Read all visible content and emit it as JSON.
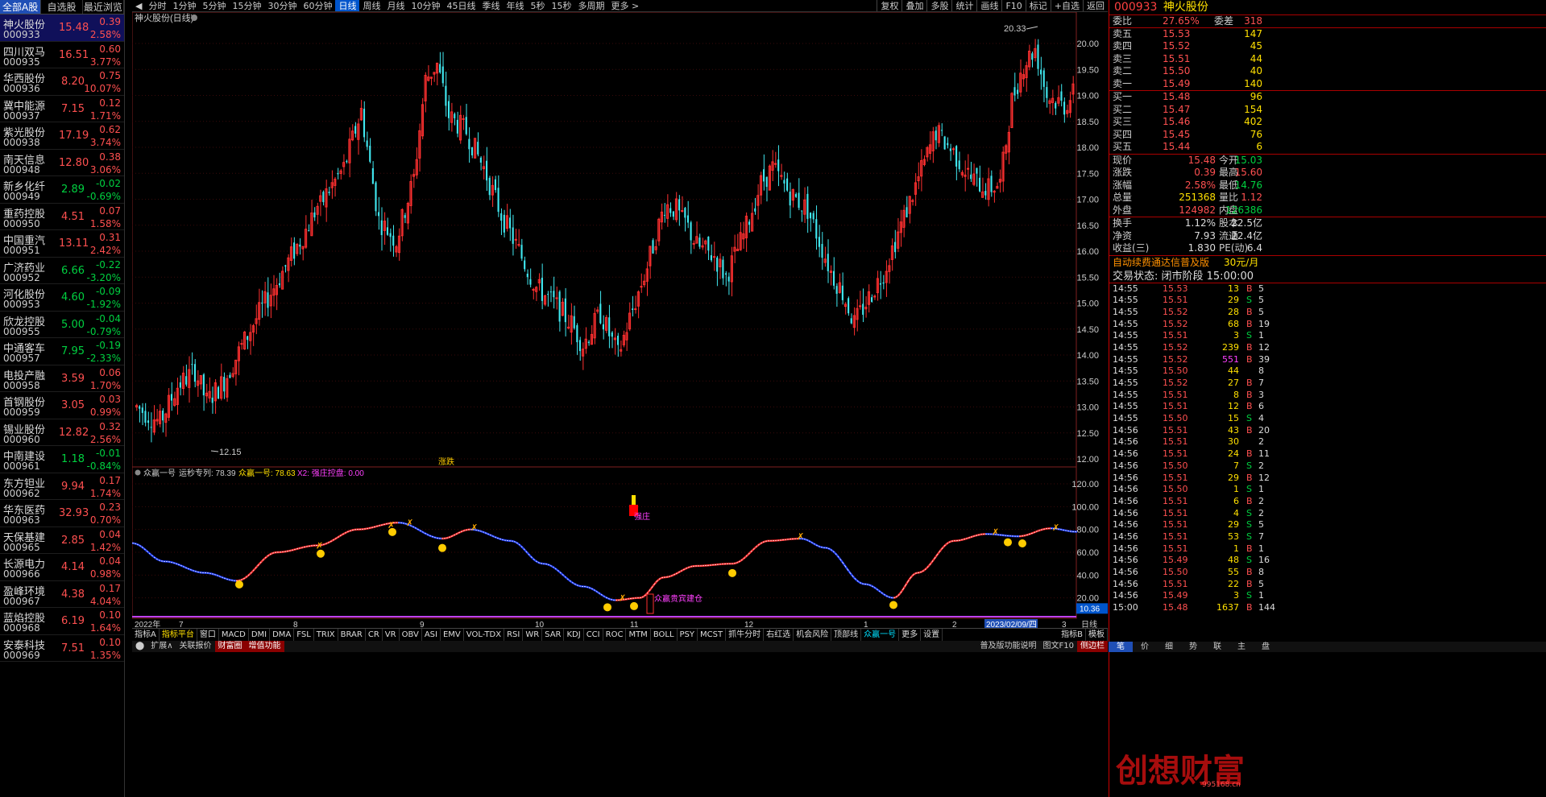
{
  "left_tabs": [
    "全部A股",
    "自选股",
    "最近浏览"
  ],
  "stocks": [
    {
      "name": "神火股份",
      "code": "000933",
      "price": "15.48",
      "chg": "0.39",
      "pct": "2.58%",
      "dir": "up",
      "sel": true
    },
    {
      "name": "四川双马",
      "code": "000935",
      "price": "16.51",
      "chg": "0.60",
      "pct": "3.77%",
      "dir": "up"
    },
    {
      "name": "华西股份",
      "code": "000936",
      "price": "8.20",
      "chg": "0.75",
      "pct": "10.07%",
      "dir": "up"
    },
    {
      "name": "冀中能源",
      "code": "000937",
      "price": "7.15",
      "chg": "0.12",
      "pct": "1.71%",
      "dir": "up"
    },
    {
      "name": "紫光股份",
      "code": "000938",
      "price": "17.19",
      "chg": "0.62",
      "pct": "3.74%",
      "dir": "up"
    },
    {
      "name": "南天信息",
      "code": "000948",
      "price": "12.80",
      "chg": "0.38",
      "pct": "3.06%",
      "dir": "up"
    },
    {
      "name": "新乡化纤",
      "code": "000949",
      "price": "2.89",
      "chg": "-0.02",
      "pct": "-0.69%",
      "dir": "dn"
    },
    {
      "name": "重药控股",
      "code": "000950",
      "price": "4.51",
      "chg": "0.07",
      "pct": "1.58%",
      "dir": "up"
    },
    {
      "name": "中国重汽",
      "code": "000951",
      "price": "13.11",
      "chg": "0.31",
      "pct": "2.42%",
      "dir": "up"
    },
    {
      "name": "广济药业",
      "code": "000952",
      "price": "6.66",
      "chg": "-0.22",
      "pct": "-3.20%",
      "dir": "dn"
    },
    {
      "name": "河化股份",
      "code": "000953",
      "price": "4.60",
      "chg": "-0.09",
      "pct": "-1.92%",
      "dir": "dn"
    },
    {
      "name": "欣龙控股",
      "code": "000955",
      "price": "5.00",
      "chg": "-0.04",
      "pct": "-0.79%",
      "dir": "dn"
    },
    {
      "name": "中通客车",
      "code": "000957",
      "price": "7.95",
      "chg": "-0.19",
      "pct": "-2.33%",
      "dir": "dn"
    },
    {
      "name": "电投产融",
      "code": "000958",
      "price": "3.59",
      "chg": "0.06",
      "pct": "1.70%",
      "dir": "up"
    },
    {
      "name": "首钢股份",
      "code": "000959",
      "price": "3.05",
      "chg": "0.03",
      "pct": "0.99%",
      "dir": "up"
    },
    {
      "name": "锡业股份",
      "code": "000960",
      "price": "12.82",
      "chg": "0.32",
      "pct": "2.56%",
      "dir": "up"
    },
    {
      "name": "中南建设",
      "code": "000961",
      "price": "1.18",
      "chg": "-0.01",
      "pct": "-0.84%",
      "dir": "dn"
    },
    {
      "name": "东方钽业",
      "code": "000962",
      "price": "9.94",
      "chg": "0.17",
      "pct": "1.74%",
      "dir": "up"
    },
    {
      "name": "华东医药",
      "code": "000963",
      "price": "32.93",
      "chg": "0.23",
      "pct": "0.70%",
      "dir": "up"
    },
    {
      "name": "天保基建",
      "code": "000965",
      "price": "2.85",
      "chg": "0.04",
      "pct": "1.42%",
      "dir": "up"
    },
    {
      "name": "长源电力",
      "code": "000966",
      "price": "4.14",
      "chg": "0.04",
      "pct": "0.98%",
      "dir": "up"
    },
    {
      "name": "盈峰环境",
      "code": "000967",
      "price": "4.38",
      "chg": "0.17",
      "pct": "4.04%",
      "dir": "up"
    },
    {
      "name": "蓝焰控股",
      "code": "000968",
      "price": "6.19",
      "chg": "0.10",
      "pct": "1.64%",
      "dir": "up"
    },
    {
      "name": "安泰科技",
      "code": "000969",
      "price": "7.51",
      "chg": "0.10",
      "pct": "1.35%",
      "dir": "up"
    }
  ],
  "topbar": {
    "periods": [
      "分时",
      "1分钟",
      "5分钟",
      "15分钟",
      "30分钟",
      "60分钟",
      "日线",
      "周线",
      "月线",
      "10分钟",
      "45日线",
      "季线",
      "年线",
      "5秒",
      "15秒",
      "多周期",
      "更多 >"
    ],
    "active": "日线",
    "right": [
      "复权",
      "叠加",
      "多股",
      "统计",
      "画线",
      "F10",
      "标记",
      "+自选",
      "返回"
    ]
  },
  "chart": {
    "title": "神火股份(日线)",
    "high_label": "20.33",
    "low_label": "12.15",
    "mark_label": "涨跌",
    "price_ticks": [
      "20.00",
      "19.50",
      "19.00",
      "18.50",
      "18.00",
      "17.50",
      "17.00",
      "16.50",
      "16.00",
      "15.50",
      "15.00",
      "14.50",
      "14.00",
      "13.50",
      "13.00",
      "12.50",
      "12.00"
    ],
    "ind_title": "众赢一号",
    "ind_items": [
      "运秒专列: 78.39",
      "众赢一号: 78.63",
      "X2: 强庄控盘: 0.00"
    ],
    "ind_ticks": [
      "120.00",
      "100.00",
      "80.00",
      "60.00",
      "40.00",
      "20.00"
    ],
    "ind_cur": "10.36",
    "ind_label1": "强庄",
    "ind_label2": "众赢贵宾建仓",
    "x_labels": [
      "2022年",
      "7",
      "8",
      "9",
      "10",
      "11",
      "12",
      "1",
      "2",
      "2023/02/09/四",
      "3"
    ],
    "x_unit": "日线"
  },
  "btmtabs": [
    "指标A",
    "指标平台",
    "窗口",
    "MACD",
    "DMI",
    "DMA",
    "FSL",
    "TRIX",
    "BRAR",
    "CR",
    "VR",
    "OBV",
    "ASI",
    "EMV",
    "VOL-TDX",
    "RSI",
    "WR",
    "SAR",
    "KDJ",
    "CCI",
    "ROC",
    "MTM",
    "BOLL",
    "PSY",
    "MCST",
    "抓牛分时",
    "右红选",
    "机会风险",
    "顶部线",
    "众赢一号",
    "更多",
    "设置",
    "指标B",
    "模板"
  ],
  "status": {
    "left": [
      "扩展∧",
      "关联报价",
      "财富圈",
      "增值功能"
    ],
    "right": [
      "普及版功能说明",
      "图文F10",
      "侧边栏"
    ]
  },
  "right": {
    "code": "000933",
    "name": "神火股份",
    "weibi": "27.65%",
    "weicha": "318",
    "asks": [
      [
        "卖五",
        "15.53",
        "147"
      ],
      [
        "卖四",
        "15.52",
        "45"
      ],
      [
        "卖三",
        "15.51",
        "44"
      ],
      [
        "卖二",
        "15.50",
        "40"
      ],
      [
        "卖一",
        "15.49",
        "140"
      ]
    ],
    "bids": [
      [
        "买一",
        "15.48",
        "96"
      ],
      [
        "买二",
        "15.47",
        "154"
      ],
      [
        "买三",
        "15.46",
        "402"
      ],
      [
        "买四",
        "15.45",
        "76"
      ],
      [
        "买五",
        "15.44",
        "6"
      ]
    ],
    "quote": [
      [
        "现价",
        "15.48",
        "今开",
        "15.03"
      ],
      [
        "涨跌",
        "0.39",
        "最高",
        "15.60"
      ],
      [
        "涨幅",
        "2.58%",
        "最低",
        "14.76"
      ],
      [
        "总量",
        "251368",
        "量比",
        "1.12"
      ],
      [
        "外盘",
        "124982",
        "内盘",
        "126386"
      ]
    ],
    "quote2": [
      [
        "换手",
        "1.12%",
        "股本",
        "22.5亿"
      ],
      [
        "净资",
        "7.93",
        "流通",
        "22.4亿"
      ],
      [
        "收益(三)",
        "1.830",
        "PE(动)",
        "6.4"
      ]
    ],
    "promo": "自动续费通达信普及版",
    "promo_price": "30元/月",
    "trade_state": "交易状态: 闭市阶段 15:00:00",
    "ticks": [
      [
        "14:55",
        "15.53",
        "13",
        "B",
        "5"
      ],
      [
        "14:55",
        "15.51",
        "29",
        "S",
        "5"
      ],
      [
        "14:55",
        "15.52",
        "28",
        "B",
        "5"
      ],
      [
        "14:55",
        "15.52",
        "68",
        "B",
        "19"
      ],
      [
        "14:55",
        "15.51",
        "3",
        "S",
        "1"
      ],
      [
        "14:55",
        "15.52",
        "239",
        "B",
        "12"
      ],
      [
        "14:55",
        "15.52",
        "551",
        "B",
        "39"
      ],
      [
        "14:55",
        "15.50",
        "44",
        "",
        "8"
      ],
      [
        "14:55",
        "15.52",
        "27",
        "B",
        "7"
      ],
      [
        "14:55",
        "15.51",
        "8",
        "B",
        "3"
      ],
      [
        "14:55",
        "15.51",
        "12",
        "B",
        "6"
      ],
      [
        "14:55",
        "15.50",
        "15",
        "S",
        "4"
      ],
      [
        "14:56",
        "15.51",
        "43",
        "B",
        "20"
      ],
      [
        "14:56",
        "15.51",
        "30",
        "",
        "2"
      ],
      [
        "14:56",
        "15.51",
        "24",
        "B",
        "11"
      ],
      [
        "14:56",
        "15.50",
        "7",
        "S",
        "2"
      ],
      [
        "14:56",
        "15.51",
        "29",
        "B",
        "12"
      ],
      [
        "14:56",
        "15.50",
        "1",
        "S",
        "1"
      ],
      [
        "14:56",
        "15.51",
        "6",
        "B",
        "2"
      ],
      [
        "14:56",
        "15.51",
        "4",
        "S",
        "2"
      ],
      [
        "14:56",
        "15.51",
        "29",
        "S",
        "5"
      ],
      [
        "14:56",
        "15.51",
        "53",
        "S",
        "7"
      ],
      [
        "14:56",
        "15.51",
        "1",
        "B",
        "1"
      ],
      [
        "14:56",
        "15.49",
        "48",
        "S",
        "16"
      ],
      [
        "14:56",
        "15.50",
        "55",
        "B",
        "8"
      ],
      [
        "14:56",
        "15.51",
        "22",
        "B",
        "5"
      ],
      [
        "14:56",
        "15.49",
        "3",
        "S",
        "1"
      ],
      [
        "15:00",
        "15.48",
        "1637",
        "B",
        "144"
      ]
    ],
    "rtabs": [
      "笔",
      "价",
      "细",
      "势",
      "联",
      "主",
      "盘"
    ]
  },
  "watermark": "创想财富",
  "watermark_url": "995168.cn",
  "colors": {
    "up": "#ff5050",
    "down": "#00d040",
    "cyan": "#40e0e0",
    "accent": "#1f4fb6"
  }
}
